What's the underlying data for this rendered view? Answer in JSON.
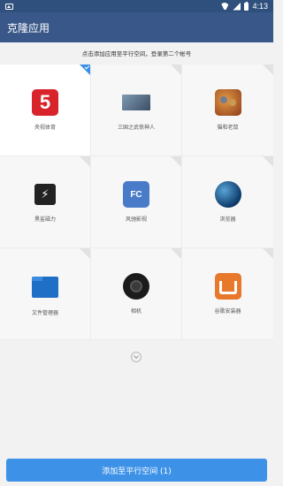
{
  "status": {
    "time": "4:13"
  },
  "header": {
    "title": "克隆应用"
  },
  "hint": "点击添加应用至平行空间，登录第二个帐号",
  "apps": [
    {
      "label": "央视体育",
      "icon": "cctv5-sports-icon",
      "selected": true
    },
    {
      "label": "三国之武侠神人",
      "icon": "game-poster-icon",
      "selected": false
    },
    {
      "label": "猫和老鼠",
      "icon": "tom-and-jerry-icon",
      "selected": false
    },
    {
      "label": "黑鲨磁力",
      "icon": "black-shark-icon",
      "selected": false
    },
    {
      "label": "风驰影视",
      "icon": "fc-video-icon",
      "selected": false
    },
    {
      "label": "浏览器",
      "icon": "browser-globe-icon",
      "selected": false
    },
    {
      "label": "文件管理器",
      "icon": "folder-icon",
      "selected": false
    },
    {
      "label": "相机",
      "icon": "camera-icon",
      "selected": false
    },
    {
      "label": "谷歌安装器",
      "icon": "google-installer-icon",
      "selected": false
    }
  ],
  "footer": {
    "add_button_label": "添加至平行空间 (1)"
  },
  "colors": {
    "title_bar": "#395889",
    "status_bar": "#2f4f7d",
    "accent": "#3d92e8"
  }
}
